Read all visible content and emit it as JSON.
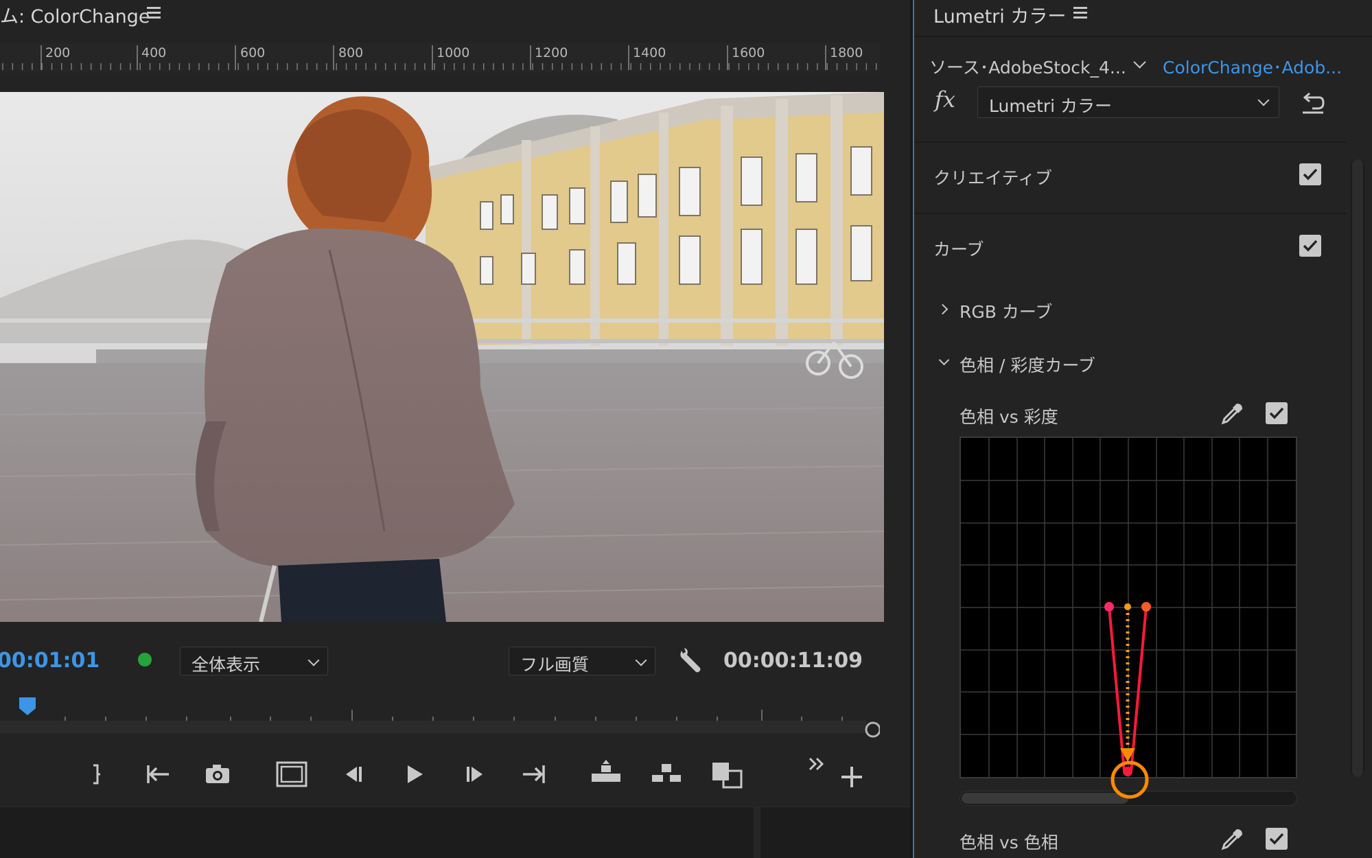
{
  "monitor": {
    "title": "ム: ColorChange",
    "ruler_ticks": [
      "200",
      "400",
      "600",
      "800",
      "1000",
      "1200",
      "1400",
      "1600",
      "1800"
    ],
    "timecode_current": "00:01:01",
    "zoom_value": "全体表示",
    "quality_value": "フル画質",
    "timecode_duration": "00:00:11:09",
    "accent_color": "#3d95e6",
    "rec_indicator_color": "#27a33a"
  },
  "lumetri": {
    "title": "Lumetri カラー",
    "source_tab": "ソース･AdobeStock_4...",
    "sequence_tab": "ColorChange･Adob...",
    "fx_label": "fx",
    "effect_name": "Lumetri カラー",
    "sections": {
      "creative": {
        "label": "クリエイティブ",
        "enabled": true
      },
      "curves": {
        "label": "カーブ",
        "enabled": true
      }
    },
    "rgb_curve_label": "RGB カーブ",
    "hue_sat_curves_label": "色相 / 彩度カーブ",
    "hue_vs_sat": {
      "label": "色相 vs 彩度",
      "enabled": true
    },
    "hue_vs_hue": {
      "label": "色相 vs 色相",
      "enabled": true
    },
    "hue_slider_position": 0.5,
    "annotation_color": "#ff8a00"
  }
}
